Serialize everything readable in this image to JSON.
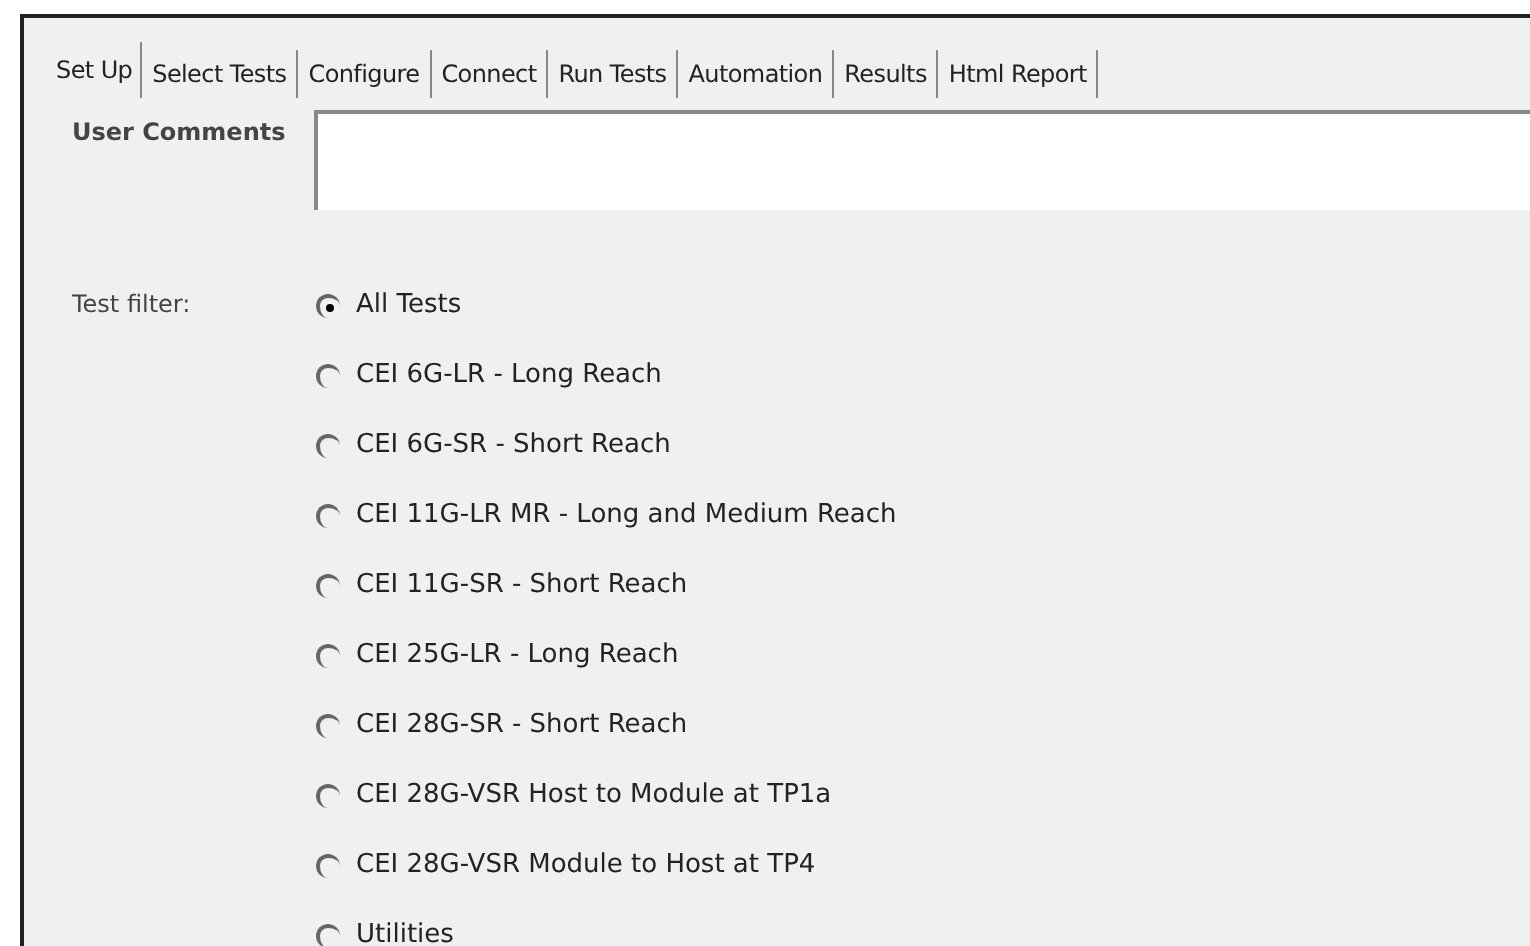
{
  "tabs": [
    {
      "label": "Set Up",
      "selected": true
    },
    {
      "label": "Select Tests",
      "selected": false
    },
    {
      "label": "Configure",
      "selected": false
    },
    {
      "label": "Connect",
      "selected": false
    },
    {
      "label": "Run Tests",
      "selected": false
    },
    {
      "label": "Automation",
      "selected": false
    },
    {
      "label": "Results",
      "selected": false
    },
    {
      "label": "Html Report",
      "selected": false
    }
  ],
  "user_comments": {
    "label": "User Comments"
  },
  "test_filter": {
    "label": "Test filter:",
    "options": [
      {
        "label": "All Tests",
        "selected": true
      },
      {
        "label": "CEI 6G-LR - Long Reach",
        "selected": false
      },
      {
        "label": "CEI 6G-SR - Short Reach",
        "selected": false
      },
      {
        "label": "CEI 11G-LR MR - Long and Medium Reach",
        "selected": false
      },
      {
        "label": "CEI 11G-SR - Short Reach",
        "selected": false
      },
      {
        "label": "CEI 25G-LR - Long Reach",
        "selected": false
      },
      {
        "label": "CEI 28G-SR - Short Reach",
        "selected": false
      },
      {
        "label": "CEI 28G-VSR Host to Module at TP1a",
        "selected": false
      },
      {
        "label": "CEI 28G-VSR Module to Host at TP4",
        "selected": false
      },
      {
        "label": "Utilities",
        "selected": false
      }
    ]
  }
}
